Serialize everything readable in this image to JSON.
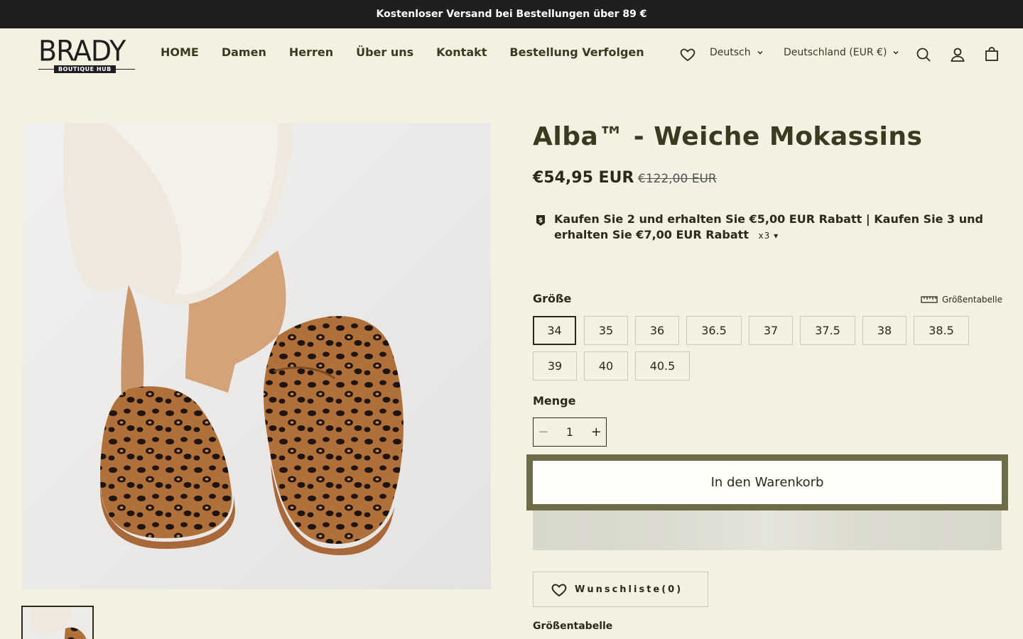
{
  "announcement": "Kostenloser Versand bei Bestellungen über 89 €",
  "logo": {
    "main": "BRADY",
    "sub": "BOUTIQUE HUB"
  },
  "nav": [
    "HOME",
    "Damen",
    "Herren",
    "Über uns",
    "Kontakt",
    "Bestellung Verfolgen"
  ],
  "language": "Deutsch",
  "country": "Deutschland (EUR €)",
  "product": {
    "title": "Alba™ - Weiche Mokassins",
    "price": "€54,95 EUR",
    "compare_price": "€122,00 EUR",
    "promo": "Kaufen Sie 2 und erhalten Sie €5,00 EUR Rabatt | Kaufen Sie 3 und erhalten Sie €7,00 EUR Rabatt",
    "promo_qty": "x3",
    "size_label": "Größe",
    "size_chart_link": "Größentabelle",
    "sizes": [
      "34",
      "35",
      "36",
      "36.5",
      "37",
      "37.5",
      "38",
      "38.5",
      "39",
      "40",
      "40.5"
    ],
    "selected_size": "34",
    "quantity_label": "Menge",
    "quantity": "1",
    "qty_minus": "−",
    "qty_plus": "+",
    "add_to_cart": "In den Warenkorb",
    "wishlist": "Wunschliste(0)",
    "size_table_title": "Größentabelle"
  },
  "colors": {
    "background": "#f3f1e1",
    "accent": "#6e6c48",
    "announce_bg": "#1f1f1f"
  },
  "icons": [
    "heart-icon",
    "chevron-down-icon",
    "search-icon",
    "account-icon",
    "cart-icon",
    "discount-tag-icon",
    "ruler-icon"
  ]
}
